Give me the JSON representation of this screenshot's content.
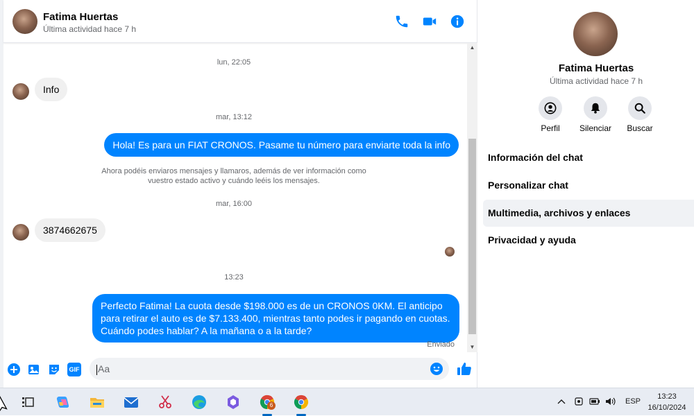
{
  "header": {
    "name": "Fatima Huertas",
    "status": "Última actividad hace 7 h"
  },
  "messages": {
    "ts1": "lun, 22:05",
    "msg1": "Info",
    "ts2": "mar, 13:12",
    "msg2": "Hola! Es para un FIAT CRONOS. Pasame tu número para enviarte toda la info",
    "system_note": "Ahora podéis enviaros mensajes y llamaros, además de ver información como vuestro estado activo y cuándo leéis los mensajes.",
    "ts3": "mar, 16:00",
    "msg3": "3874662675",
    "ts4": "13:23",
    "msg4": "Perfecto Fatima! La cuota desde $198.000 es de un CRONOS 0KM. El anticipo para retirar el auto es de $7.133.400, mientras tanto podes ir pagando en cuotas. Cuándo podes hablar? A la mañana o a la tarde?",
    "sent_label": "Enviado"
  },
  "composer": {
    "placeholder": "Aa",
    "icons": [
      "plus-icon",
      "image-icon",
      "sticker-icon",
      "gif-icon",
      "emoji-icon",
      "thumbs-up-icon"
    ],
    "gif_label": "GIF"
  },
  "side": {
    "name": "Fatima Huertas",
    "status": "Última actividad hace 7 h",
    "buttons": [
      {
        "label": "Perfil",
        "icon": "profile-icon"
      },
      {
        "label": "Silenciar",
        "icon": "bell-icon"
      },
      {
        "label": "Buscar",
        "icon": "search-icon"
      }
    ],
    "items": [
      {
        "label": "Información del chat"
      },
      {
        "label": "Personalizar chat"
      },
      {
        "label": "Multimedia, archivos y enlaces"
      },
      {
        "label": "Privacidad y ayuda"
      }
    ]
  },
  "taskbar": {
    "lang": "ESP",
    "time": "13:23",
    "date": "16/10/2024",
    "badge": "6"
  },
  "colors": {
    "accent": "#0084ff",
    "incoming_bubble": "#f0f0f0",
    "muted_text": "#65676b"
  }
}
